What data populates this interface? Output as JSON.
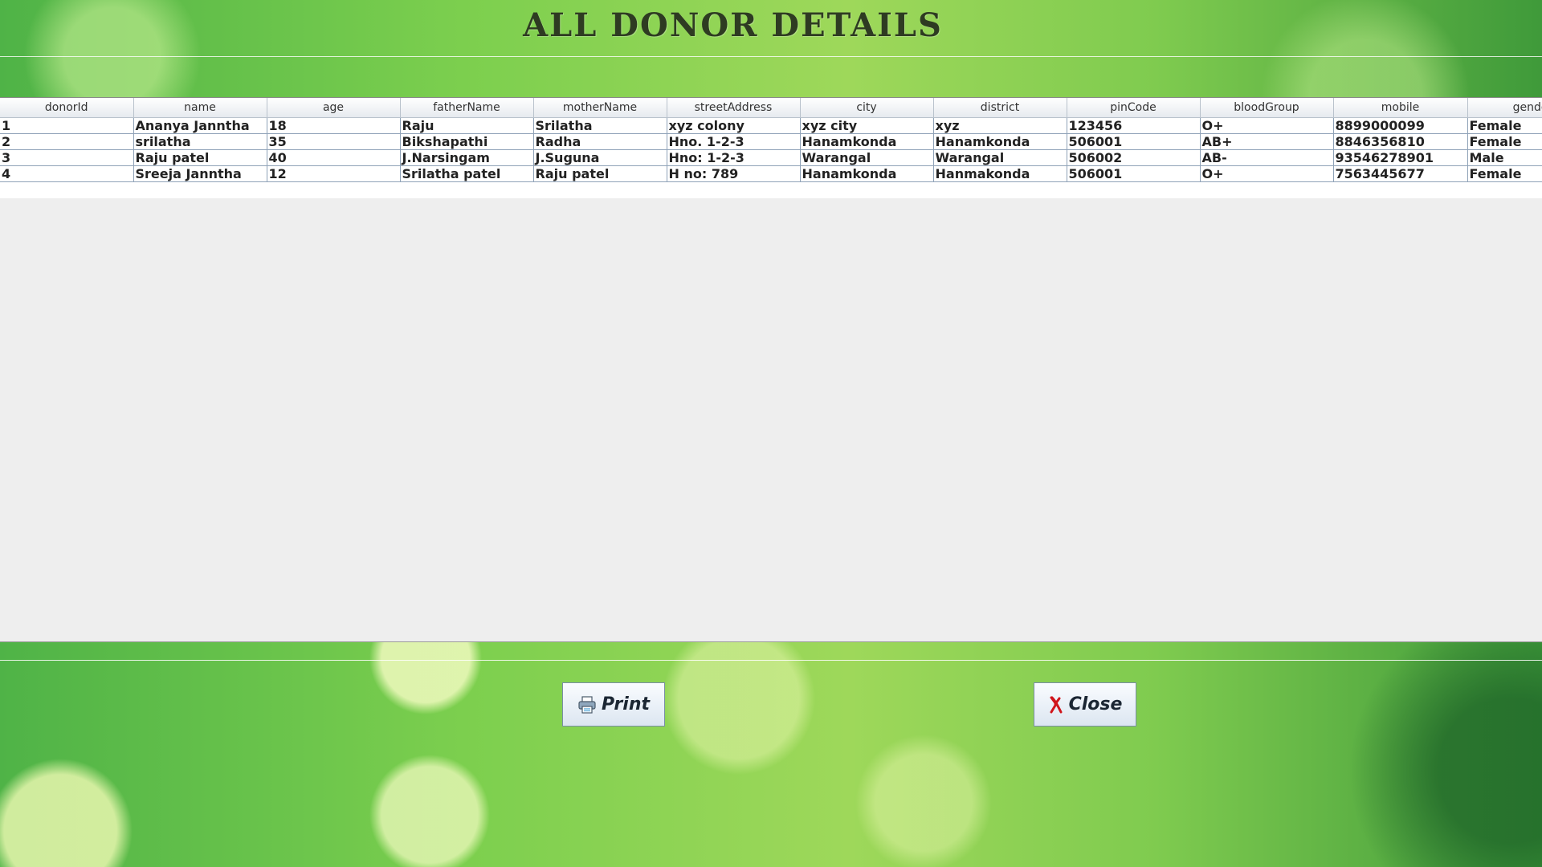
{
  "title": "ALL DONOR DETAILS",
  "table": {
    "columns": [
      "donorId",
      "name",
      "age",
      "fatherName",
      "motherName",
      "streetAddress",
      "city",
      "district",
      "pinCode",
      "bloodGroup",
      "mobile",
      "gender"
    ],
    "rows": [
      [
        "1",
        "Ananya Janntha",
        "18",
        "Raju",
        "Srilatha",
        "xyz colony",
        "xyz city",
        "xyz",
        "123456",
        "O+",
        "8899000099",
        "Female"
      ],
      [
        "2",
        "srilatha",
        "35",
        "Bikshapathi",
        "Radha",
        "Hno. 1-2-3",
        "Hanamkonda",
        "Hanamkonda",
        "506001",
        "AB+",
        "8846356810",
        "Female"
      ],
      [
        "3",
        "Raju patel",
        "40",
        "J.Narsingam",
        "J.Suguna",
        "Hno: 1-2-3",
        "Warangal",
        "Warangal",
        "506002",
        "AB-",
        "93546278901",
        "Male"
      ],
      [
        "4",
        "Sreeja Janntha",
        "12",
        "Srilatha patel",
        "Raju patel",
        "H no: 789",
        "Hanamkonda",
        "Hanmakonda",
        "506001",
        "O+",
        "7563445677",
        "Female"
      ]
    ]
  },
  "buttons": {
    "print": {
      "label": "Print",
      "icon": "printer-icon"
    },
    "close": {
      "label": "Close",
      "icon": "close-x-icon",
      "icon_color": "#d0151b"
    }
  }
}
